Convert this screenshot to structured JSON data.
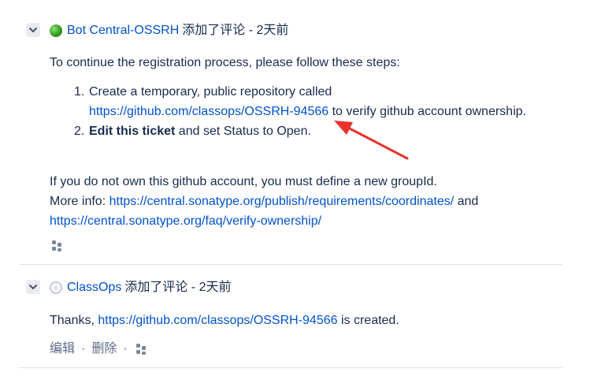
{
  "comments": [
    {
      "author": "Bot Central-OSSRH",
      "action": "添加了评论 - 2天前",
      "intro": "To continue the registration process, please follow these steps:",
      "steps": [
        {
          "number": "1.",
          "text_before": "Create a temporary, public repository called",
          "link": "https://github.com/classops/OSSRH-94566",
          "text_after": " to verify github account ownership."
        },
        {
          "number": "2.",
          "bold": "Edit this ticket",
          "text_after": " and set Status to Open."
        }
      ],
      "tail_line1": "If you do not own this github account, you must define a new groupId.",
      "more_info_label": "More info: ",
      "more_info_link1": "https://central.sonatype.org/publish/requirements/coordinates/",
      "and": " and",
      "more_info_link2": "https://central.sonatype.org/faq/verify-ownership/"
    },
    {
      "author": "ClassOps",
      "action": "添加了评论 - 2天前",
      "text_before": "Thanks, ",
      "link": "https://github.com/classops/OSSRH-94566",
      "text_after": " is created.",
      "edit_label": "编辑",
      "delete_label": "删除",
      "separator": "·"
    }
  ],
  "colors": {
    "link": "#0052cc",
    "text": "#172b4d",
    "muted": "#5e6c84",
    "arrow": "#e8322c"
  },
  "icons": {
    "collapse": "chevron-down-icon",
    "permalink": "permalink-icon"
  }
}
